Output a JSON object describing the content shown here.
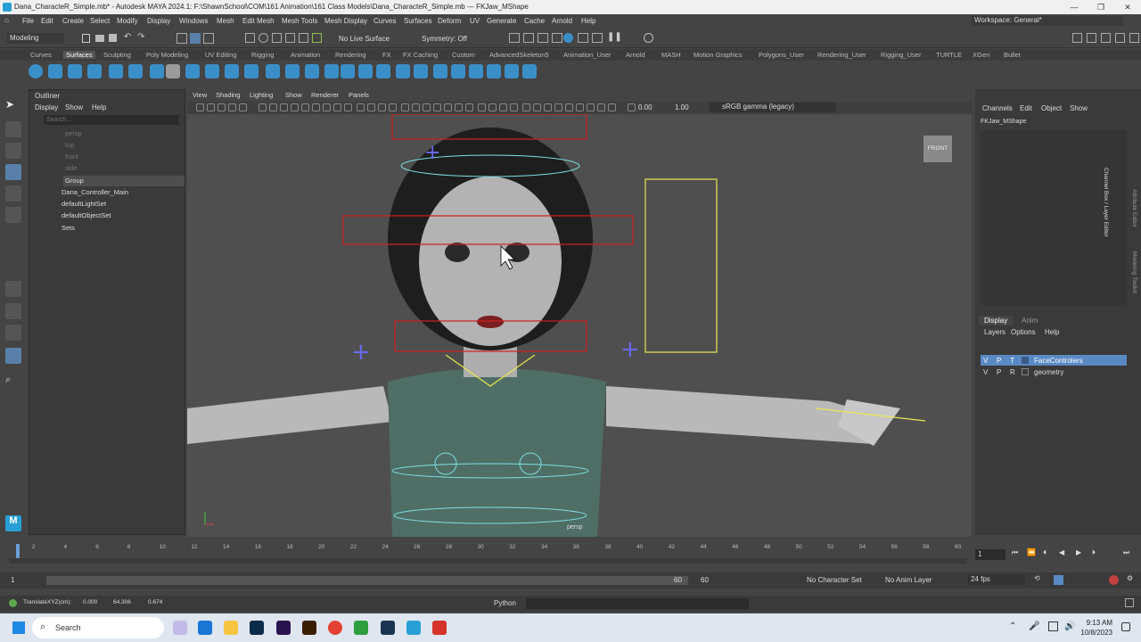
{
  "title": "Dana_CharacteR_Simple.mb* - Autodesk MAYA 2024.1: F:\\ShawnSchool\\COM\\161  Animation\\161 Class Models\\Dana_CharacteR_Simple.mb   ---   FKJaw_MShape",
  "window_controls": [
    "—",
    "❐",
    "✕"
  ],
  "menus": [
    "File",
    "Edit",
    "Create",
    "Select",
    "Modify",
    "Display",
    "Windows",
    "Mesh",
    "Edit Mesh",
    "Mesh Tools",
    "Mesh Display",
    "Curves",
    "Surfaces",
    "Deform",
    "UV",
    "Generate",
    "Cache",
    "Arnold",
    "Help"
  ],
  "workspace": "Workspace:  General*",
  "status": {
    "mode": "Modeling",
    "live": "No Live Surface",
    "symmetry": "Symmetry: Off"
  },
  "shelf_tabs": [
    "Curves",
    "Surfaces",
    "Sculpting",
    "Poly Modeling",
    "UV Editing",
    "Rigging",
    "Animation",
    "Rendering",
    "FX",
    "FX Caching",
    "Custom",
    "AdvancedSkeleton5",
    "Animation_User",
    "Arnold",
    "MASH",
    "Motion Graphics",
    "Polygons_User",
    "Rendering_User",
    "Rigging_User",
    "TURTLE",
    "XGen",
    "Bullet"
  ],
  "shelf_icons": [
    "sphere",
    "cube",
    "cylinder",
    "cone",
    "torus",
    "plane",
    "disc",
    "pipe",
    "helix",
    "soccer",
    "platonic",
    "bevel",
    "combine",
    "separate",
    "extract",
    "bridge",
    "fill",
    "append",
    "multicut",
    "insert-loop",
    "offset-loop",
    "extrude",
    "poke",
    "wedge",
    "chamfer",
    "crease",
    "target-weld"
  ],
  "outliner": {
    "title": "Outliner",
    "menu": [
      "Display",
      "Show",
      "Help"
    ],
    "search_placeholder": "Search...",
    "items": [
      "persp",
      "top",
      "front",
      "side",
      "Group",
      "Dana_Controller_Main",
      "defaultLightSet",
      "defaultObjectSet",
      "Sets"
    ]
  },
  "viewport": {
    "menu": [
      "View",
      "Shading",
      "Lighting",
      "Show",
      "Renderer",
      "Panels"
    ],
    "exposure": "0.00",
    "gamma": "1.00",
    "colorspace": "sRGB gamma (legacy)",
    "camera_label": "persp",
    "viewcube": "FRONT"
  },
  "channel_box": {
    "menu": [
      "Channels",
      "Edit",
      "Object",
      "Show"
    ],
    "object": "FKJaw_MShape",
    "side_tabs": [
      "Channel Box / Layer Editor",
      "Attribute Editor",
      "Modeling Toolkit"
    ],
    "layer_tabs": [
      "Display",
      "Anim"
    ],
    "layer_menu": [
      "Layers",
      "Options",
      "Help"
    ],
    "layers": [
      {
        "v": "V",
        "p": "P",
        "t": "T",
        "name": "FaceControlers",
        "selected": true
      },
      {
        "v": "V",
        "p": "P",
        "t": "R",
        "name": "geometry",
        "selected": false
      }
    ]
  },
  "timeline": {
    "ticks": [
      "2",
      "4",
      "6",
      "8",
      "10",
      "12",
      "14",
      "16",
      "18",
      "20",
      "22",
      "24",
      "26",
      "28",
      "30",
      "32",
      "34",
      "36",
      "38",
      "40",
      "42",
      "44",
      "46",
      "48",
      "50",
      "52",
      "54",
      "56",
      "58",
      "60"
    ],
    "current_frame": "1",
    "range_start": "1",
    "range_inner_start": "1",
    "range_inner_end": "60",
    "range_end": "60",
    "character_set": "No Character Set",
    "anim_layer": "No Anim Layer",
    "fps": "24 fps"
  },
  "feedback": {
    "label": "TranslateXYZ(cm):",
    "x": "0.000",
    "y": "64.306",
    "z": "0.674",
    "lang": "Python"
  },
  "taskbar": {
    "search": "Search",
    "time": "9:13 AM",
    "date": "10/8/2023"
  },
  "colors": {
    "selected_layer": "#5a8ac4",
    "ctrl_yellow": "#e8e850",
    "ctrl_cyan": "#7fe0e0",
    "ctrl_red": "#d02020"
  }
}
